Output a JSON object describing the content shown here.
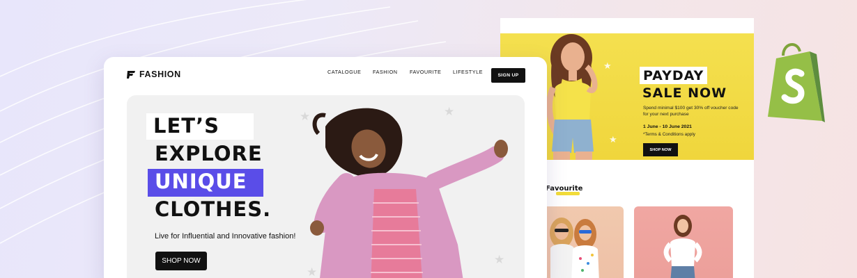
{
  "brand": {
    "name": "FASHION"
  },
  "nav": {
    "items": [
      {
        "label": "CATALOGUE"
      },
      {
        "label": "FASHION"
      },
      {
        "label": "FAVOURITE"
      },
      {
        "label": "LIFESTYLE"
      }
    ],
    "signup_label": "SIGN UP"
  },
  "hero": {
    "headline": [
      "LET’S",
      "EXPLORE",
      "UNIQUE",
      "CLOTHES."
    ],
    "subtitle": "Live for Influential and Innovative fashion!",
    "cta_label": "SHOP NOW"
  },
  "promo": {
    "title_line_1": "PAYDAY",
    "title_line_2": "SALE NOW",
    "description": "Spend minimal $100 get 30% off voucher code for your next purchase",
    "dates": "1 June - 10 June 2021",
    "terms": "*Terms & Conditions apply",
    "cta_label": "SHOP NOW"
  },
  "favourite": {
    "heading": "Favourite"
  },
  "colors": {
    "accent_purple": "#5a4de8",
    "promo_yellow": "#f2dc3a",
    "shopify_green": "#95bf47",
    "dark": "#111111"
  },
  "icons": [
    "fashion-logo-icon",
    "star-icon",
    "shopify-bag-icon"
  ]
}
